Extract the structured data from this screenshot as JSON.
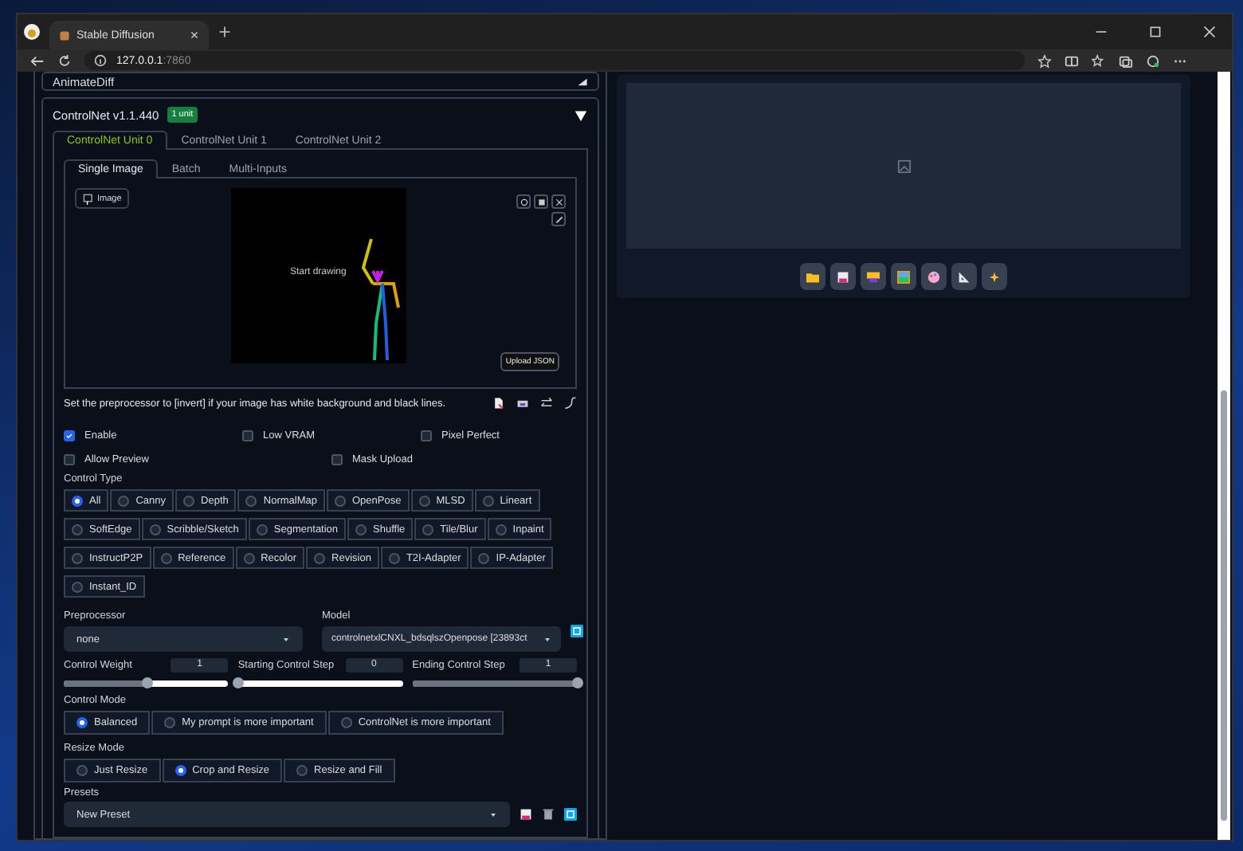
{
  "browser": {
    "tab_title": "Stable Diffusion",
    "address_host": "127.0.0.1",
    "address_port": ":7860"
  },
  "animatediff": {
    "title": "AnimateDiff"
  },
  "controlnet": {
    "title": "ControlNet v1.1.440",
    "badge": "1 unit",
    "expanded": true,
    "unit_tabs": [
      {
        "label": "ControlNet Unit 0",
        "selected": true
      },
      {
        "label": "ControlNet Unit 1",
        "selected": false
      },
      {
        "label": "ControlNet Unit 2",
        "selected": false
      }
    ],
    "input_tabs": [
      {
        "label": "Single Image",
        "selected": true
      },
      {
        "label": "Batch",
        "selected": false
      },
      {
        "label": "Multi-Inputs",
        "selected": false
      }
    ],
    "image_label": "Image",
    "canvas_text": "Start drawing",
    "upload_json": "Upload JSON",
    "hint": "Set the preprocessor to [invert] if your image has white background and black lines.",
    "checkboxes": [
      {
        "label": "Enable",
        "checked": true
      },
      {
        "label": "Low VRAM",
        "checked": false
      },
      {
        "label": "Pixel Perfect",
        "checked": false
      },
      {
        "label": "Allow Preview",
        "checked": false
      },
      {
        "label": "Mask Upload",
        "checked": false
      }
    ],
    "control_type": {
      "label": "Control Type",
      "options": [
        {
          "label": "All",
          "selected": true
        },
        {
          "label": "Canny",
          "selected": false
        },
        {
          "label": "Depth",
          "selected": false
        },
        {
          "label": "NormalMap",
          "selected": false
        },
        {
          "label": "OpenPose",
          "selected": false
        },
        {
          "label": "MLSD",
          "selected": false
        },
        {
          "label": "Lineart",
          "selected": false
        },
        {
          "label": "SoftEdge",
          "selected": false
        },
        {
          "label": "Scribble/Sketch",
          "selected": false
        },
        {
          "label": "Segmentation",
          "selected": false
        },
        {
          "label": "Shuffle",
          "selected": false
        },
        {
          "label": "Tile/Blur",
          "selected": false
        },
        {
          "label": "Inpaint",
          "selected": false
        },
        {
          "label": "InstructP2P",
          "selected": false
        },
        {
          "label": "Reference",
          "selected": false
        },
        {
          "label": "Recolor",
          "selected": false
        },
        {
          "label": "Revision",
          "selected": false
        },
        {
          "label": "T2I-Adapter",
          "selected": false
        },
        {
          "label": "IP-Adapter",
          "selected": false
        },
        {
          "label": "Instant_ID",
          "selected": false
        }
      ]
    },
    "preprocessor": {
      "label": "Preprocessor",
      "value": "none"
    },
    "model": {
      "label": "Model",
      "value": "controlnetxlCNXL_bdsqlszOpenpose [23893ct"
    },
    "sliders": [
      {
        "label": "Control Weight",
        "value": "1",
        "level": 0.5
      },
      {
        "label": "Starting Control Step",
        "value": "0",
        "level": 0
      },
      {
        "label": "Ending Control Step",
        "value": "1",
        "level": 1
      }
    ],
    "control_mode": {
      "label": "Control Mode",
      "options": [
        {
          "label": "Balanced",
          "selected": true
        },
        {
          "label": "My prompt is more important",
          "selected": false
        },
        {
          "label": "ControlNet is more important",
          "selected": false
        }
      ]
    },
    "resize_mode": {
      "label": "Resize Mode",
      "options": [
        {
          "label": "Just Resize",
          "selected": false
        },
        {
          "label": "Crop and Resize",
          "selected": true
        },
        {
          "label": "Resize and Fill",
          "selected": false
        }
      ]
    },
    "presets": {
      "label": "Presets",
      "value": "New Preset"
    }
  }
}
